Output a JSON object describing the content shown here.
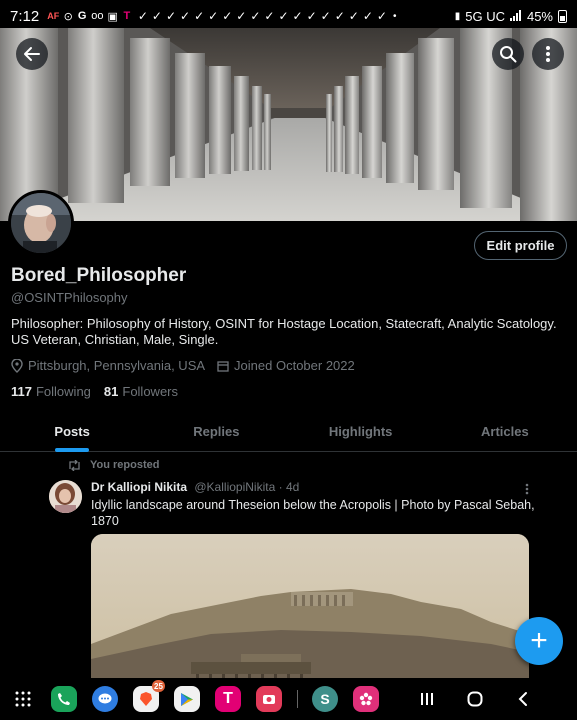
{
  "status_bar": {
    "time": "7:12",
    "left_icons": [
      "AF",
      "⊙",
      "G",
      "oo",
      "▣",
      "T"
    ],
    "check_count": 18,
    "dot": "•",
    "network": "5G UC",
    "battery": "45%"
  },
  "header": {
    "back_icon": "arrow-left-icon",
    "search_icon": "search-icon",
    "more_icon": "more-vertical-icon"
  },
  "profile": {
    "edit_button": "Edit profile",
    "display_name": "Bored_Philosopher",
    "handle": "@OSINTPhilosophy",
    "bio": "Philosopher: Philosophy of History, OSINT for Hostage Location, Statecraft, Analytic Scatology. US Veteran, Christian, Male, Single.",
    "location": "Pittsburgh, Pennsylvania, USA",
    "joined": "Joined October 2022",
    "following_count": "117",
    "following_label": "Following",
    "followers_count": "81",
    "followers_label": "Followers"
  },
  "tabs": [
    {
      "label": "Posts",
      "active": true
    },
    {
      "label": "Replies",
      "active": false
    },
    {
      "label": "Highlights",
      "active": false
    },
    {
      "label": "Articles",
      "active": false
    }
  ],
  "post": {
    "repost_label": "You reposted",
    "author_name": "Dr Kalliopi Nikita",
    "author_handle": "@KalliopiNikita",
    "time": "· 4d",
    "text": "Idyllic landscape around Theseion below the Acropolis | Photo by Pascal Sebah, 1870"
  },
  "fab": {
    "label": "+"
  },
  "nav_bar": {
    "apps": [
      {
        "name": "apps-grid",
        "color": "#000000"
      },
      {
        "name": "phone",
        "color": "#1aa35a"
      },
      {
        "name": "messages",
        "color": "#2f7de1"
      },
      {
        "name": "brave",
        "color": "#f1f1f1",
        "badge": "25"
      },
      {
        "name": "play-store",
        "color": "#f1f1f1"
      },
      {
        "name": "t-mobile",
        "color": "#e20074"
      },
      {
        "name": "camera",
        "color": "#e23b5a"
      },
      {
        "name": "signal-like",
        "color": "#3f8f8a"
      },
      {
        "name": "blossom",
        "color": "#e0307a"
      }
    ]
  },
  "colors": {
    "accent": "#1d9bf0",
    "muted": "#71767b",
    "text": "#e7e9ea"
  }
}
